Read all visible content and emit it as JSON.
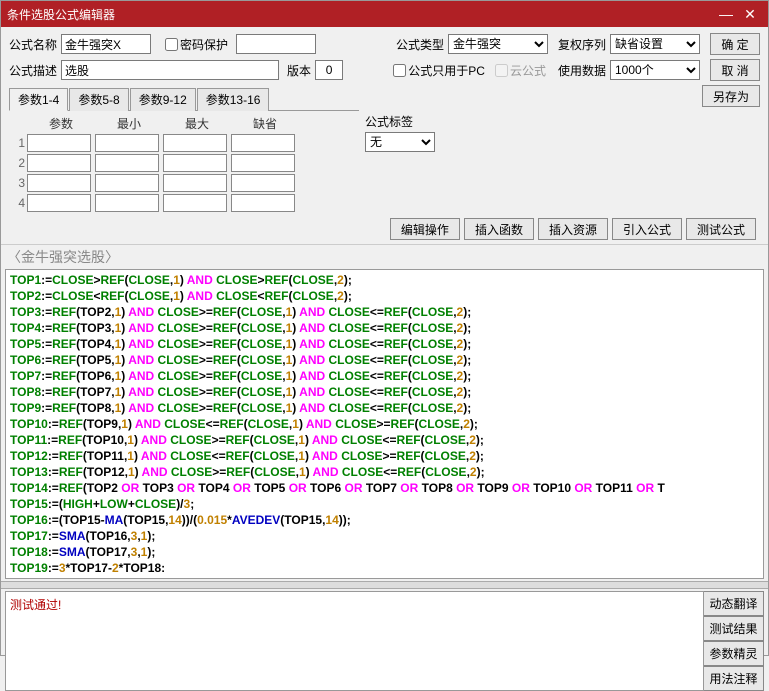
{
  "title": "条件选股公式编辑器",
  "titlebar": {
    "minimize": "—",
    "close": "✕"
  },
  "form": {
    "name_lbl": "公式名称",
    "name_val": "金牛强突X",
    "pwd_lbl": "密码保护",
    "type_lbl": "公式类型",
    "type_val": "金牛强突",
    "reseq_lbl": "复权序列",
    "reseq_val": "缺省设置",
    "ok": "确 定",
    "cancel": "取 消",
    "saveas": "另存为",
    "desc_lbl": "公式描述",
    "desc_val": "选股",
    "ver_lbl": "版本",
    "ver_val": "0",
    "pconly_lbl": "公式只用于PC",
    "cloud_lbl": "云公式",
    "usedata_lbl": "使用数据",
    "usedata_val": "1000个",
    "tag_lbl": "公式标签",
    "tag_val": "无"
  },
  "tabs": [
    "参数1-4",
    "参数5-8",
    "参数9-12",
    "参数13-16"
  ],
  "param_hdr": {
    "c1": "参数",
    "c2": "最小",
    "c3": "最大",
    "c4": "缺省"
  },
  "actions": {
    "editop": "编辑操作",
    "insfn": "插入函数",
    "insres": "插入资源",
    "impfm": "引入公式",
    "test": "测试公式"
  },
  "editor_title": "〈金牛强突选股〉",
  "lines": [
    "TOP1:=|CLOSE|>|REF|(|CLOSE|,|1|) |AND| |CLOSE|>|REF|(|CLOSE|,|2|);",
    "TOP2:=|CLOSE|<|REF|(|CLOSE|,|1|) |AND| |CLOSE|<|REF|(|CLOSE|,|2|);",
    "TOP3:=|REF|(TOP2,|1|) |AND| |CLOSE|>=|REF|(|CLOSE|,|1|) |AND| |CLOSE|<=|REF|(|CLOSE|,|2|);",
    "TOP4:=|REF|(TOP3,|1|) |AND| |CLOSE|>=|REF|(|CLOSE|,|1|) |AND| |CLOSE|<=|REF|(|CLOSE|,|2|);",
    "TOP5:=|REF|(TOP4,|1|) |AND| |CLOSE|>=|REF|(|CLOSE|,|1|) |AND| |CLOSE|<=|REF|(|CLOSE|,|2|);",
    "TOP6:=|REF|(TOP5,|1|) |AND| |CLOSE|>=|REF|(|CLOSE|,|1|) |AND| |CLOSE|<=|REF|(|CLOSE|,|2|);",
    "TOP7:=|REF|(TOP6,|1|) |AND| |CLOSE|>=|REF|(|CLOSE|,|1|) |AND| |CLOSE|<=|REF|(|CLOSE|,|2|);",
    "TOP8:=|REF|(TOP7,|1|) |AND| |CLOSE|>=|REF|(|CLOSE|,|1|) |AND| |CLOSE|<=|REF|(|CLOSE|,|2|);",
    "TOP9:=|REF|(TOP8,|1|) |AND| |CLOSE|>=|REF|(|CLOSE|,|1|) |AND| |CLOSE|<=|REF|(|CLOSE|,|2|);",
    "TOP10:=|REF|(TOP9,|1|) |AND| |CLOSE|<=|REF|(|CLOSE|,|1|) |AND| |CLOSE|>=|REF|(|CLOSE|,|2|);",
    "TOP11:=|REF|(TOP10,|1|) |AND| |CLOSE|>=|REF|(|CLOSE|,|1|) |AND| |CLOSE|<=|REF|(|CLOSE|,|2|);",
    "TOP12:=|REF|(TOP11,|1|) |AND| |CLOSE|<=|REF|(|CLOSE|,|1|) |AND| |CLOSE|>=|REF|(|CLOSE|,|2|);",
    "TOP13:=|REF|(TOP12,|1|) |AND| |CLOSE|>=|REF|(|CLOSE|,|1|) |AND| |CLOSE|<=|REF|(|CLOSE|,|2|);",
    "TOP14:=|REF|(TOP2 |OR| TOP3 |OR| TOP4 |OR| TOP5 |OR| TOP6 |OR| TOP7 |OR| TOP8 |OR| TOP9 |OR| TOP10 |OR| TOP11 |OR| T",
    "TOP15:=(|HIGH|+|LOW|+|CLOSE|)/|3|;",
    "TOP16:=(TOP15-~MA~(TOP15,|14|))/(|0.015|*~AVEDEV~(TOP15,|14|));",
    "TOP17:=~SMA~(TOP16,|3|,|1|);",
    "TOP18:=~SMA~(TOP17,|3|,|1|);",
    "TOP19:=|3|*TOP17-|2|*TOP18:"
  ],
  "log": "测试通过!",
  "sidebtns": {
    "dyntrans": "动态翻译",
    "testres": "测试结果",
    "paramwiz": "参数精灵",
    "usage": "用法注释"
  }
}
